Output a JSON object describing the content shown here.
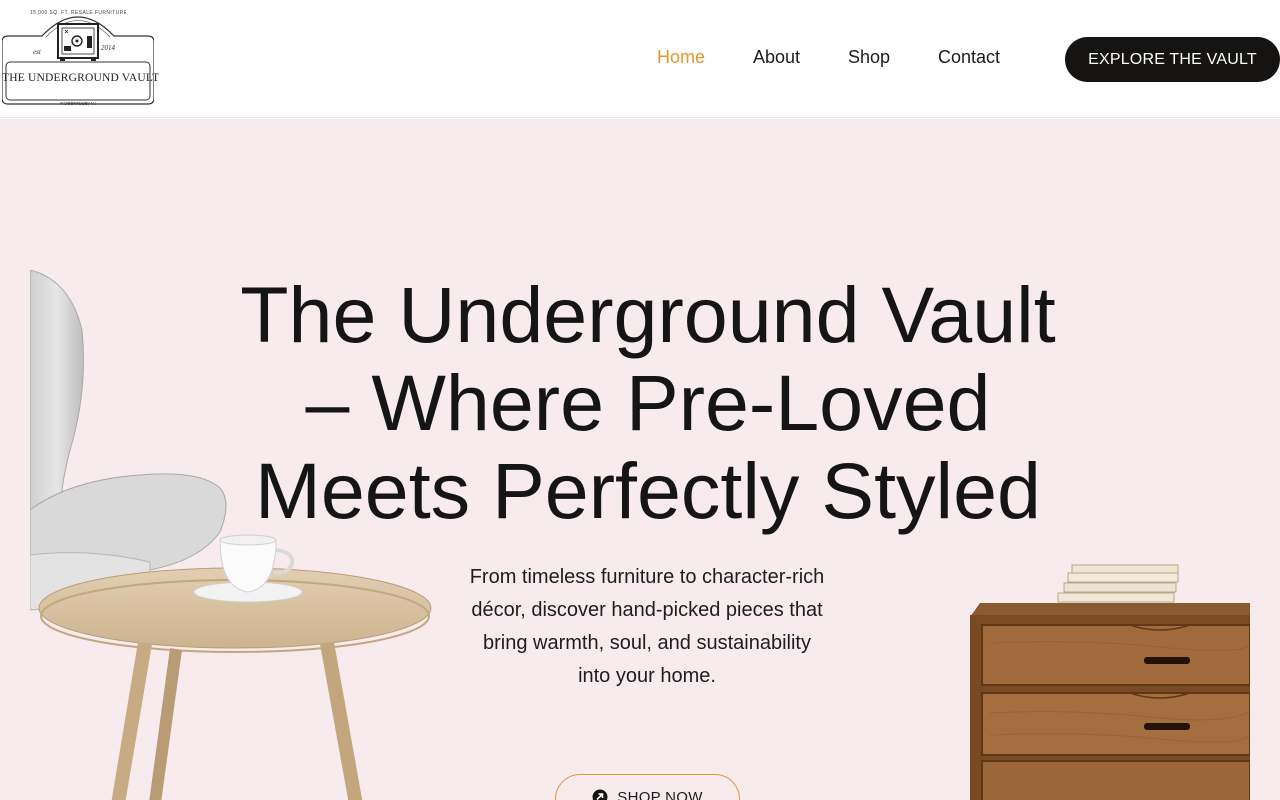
{
  "brand": {
    "name": "THE UNDERGROUND VAULT",
    "arc_text": "15,000 SQ. FT. RESALE FURNITURE WAREHOUSE",
    "est_label": "est",
    "year": "2014",
    "location": "ROSSVILLE, NC"
  },
  "nav": {
    "items": [
      {
        "label": "Home",
        "active": true
      },
      {
        "label": "About",
        "active": false
      },
      {
        "label": "Shop",
        "active": false
      },
      {
        "label": "Contact",
        "active": false
      }
    ],
    "cta_label": "EXPLORE THE VAULT"
  },
  "hero": {
    "title_line1": "The Underground Vault",
    "title_line2": "– Where Pre-Loved",
    "title_line3": "Meets Perfectly Styled",
    "description": "From timeless furniture to character-rich décor, discover hand-picked pieces that bring warmth, soul, and sustainability into your home.",
    "button_label": "SHOP NOW"
  },
  "colors": {
    "accent": "#e2972f",
    "hero_background": "#f7ebee",
    "cta_background": "#161412",
    "text": "#151515"
  },
  "icons": {
    "shop_button": "arrow-circle-icon",
    "logo": "vault-safe-icon"
  }
}
